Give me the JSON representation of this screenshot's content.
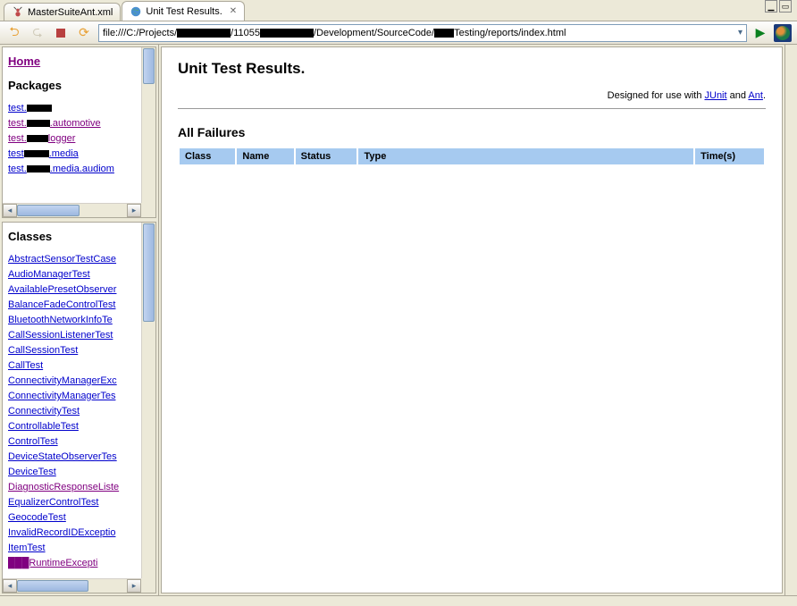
{
  "tabs": [
    {
      "label": "MasterSuiteAnt.xml",
      "icon": "ant-icon",
      "active": false
    },
    {
      "label": "Unit Test Results.",
      "icon": "globe-icon",
      "active": true
    }
  ],
  "address_bar": {
    "url_parts": [
      "file:///C:/Projects/",
      "[BLK:60]",
      "/11055",
      "[BLK:60]",
      "/Development/SourceCode/",
      "[BLK:22]",
      "Testing/reports/index.html"
    ]
  },
  "packages_pane": {
    "home_label": "Home",
    "heading": "Packages",
    "items": [
      {
        "parts": [
          "test.",
          "[BLK:28]"
        ],
        "visited": false
      },
      {
        "parts": [
          "test.",
          "[BLK:26]",
          ".automotive"
        ],
        "visited": true
      },
      {
        "parts": [
          "test.",
          "[BLK:24]",
          "logger"
        ],
        "visited": true
      },
      {
        "parts": [
          "test",
          "[BLK:28]",
          ".media"
        ],
        "visited": false
      },
      {
        "parts": [
          "test.",
          "[BLK:26]",
          ".media.audiom"
        ],
        "visited": false
      }
    ]
  },
  "classes_pane": {
    "heading": "Classes",
    "items": [
      {
        "label": "AbstractSensorTestCase",
        "visited": false
      },
      {
        "label": "AudioManagerTest",
        "visited": false
      },
      {
        "label": "AvailablePresetObserver",
        "visited": false
      },
      {
        "label": "BalanceFadeControlTest",
        "visited": false
      },
      {
        "label": "BluetoothNetworkInfoTe",
        "visited": false
      },
      {
        "label": "CallSessionListenerTest",
        "visited": false
      },
      {
        "label": "CallSessionTest",
        "visited": false
      },
      {
        "label": "CallTest",
        "visited": false
      },
      {
        "label": "ConnectivityManagerExc",
        "visited": false
      },
      {
        "label": "ConnectivityManagerTes",
        "visited": false
      },
      {
        "label": "ConnectivityTest",
        "visited": false
      },
      {
        "label": "ControllableTest",
        "visited": false
      },
      {
        "label": "ControlTest",
        "visited": false
      },
      {
        "label": "DeviceStateObserverTes",
        "visited": false
      },
      {
        "label": "DeviceTest",
        "visited": false
      },
      {
        "label": "DiagnosticResponseListe",
        "visited": true
      },
      {
        "label": "EqualizerControlTest",
        "visited": false
      },
      {
        "label": "GeocodeTest",
        "visited": false
      },
      {
        "label": "InvalidRecordIDExceptio",
        "visited": false
      },
      {
        "label": "ItemTest",
        "visited": false
      },
      {
        "label": "███RuntimeExcepti",
        "visited": true
      }
    ]
  },
  "main": {
    "title": "Unit Test Results.",
    "designed_prefix": "Designed for use with ",
    "junit_label": "JUnit",
    "and_label": " and ",
    "ant_label": "Ant",
    "period": ".",
    "failures_heading": "All Failures",
    "columns": {
      "class": "Class",
      "name": "Name",
      "status": "Status",
      "type": "Type",
      "time": "Time(s)"
    }
  }
}
